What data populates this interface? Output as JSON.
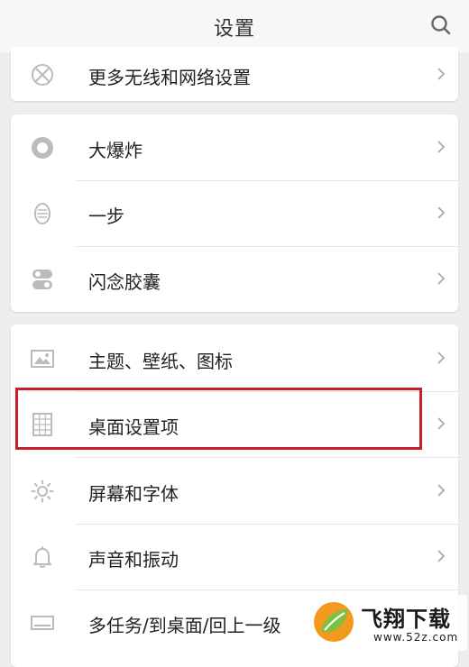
{
  "header": {
    "title": "设置",
    "search_icon": "search-icon"
  },
  "groups": [
    {
      "items": [
        {
          "label": "更多无线和网络设置",
          "icon": "network-globe-icon"
        }
      ]
    },
    {
      "items": [
        {
          "label": "大爆炸",
          "icon": "big-bang-icon"
        },
        {
          "label": "一步",
          "icon": "one-step-icon"
        },
        {
          "label": "闪念胶囊",
          "icon": "capsule-icon"
        }
      ]
    },
    {
      "items": [
        {
          "label": "主题、壁纸、图标",
          "icon": "image-icon"
        },
        {
          "label": "桌面设置项",
          "icon": "grid-icon",
          "highlighted": true
        },
        {
          "label": "屏幕和字体",
          "icon": "brightness-icon"
        },
        {
          "label": "声音和振动",
          "icon": "bell-icon"
        },
        {
          "label": "多任务/到桌面/回上一级",
          "icon": "keyboard-icon"
        }
      ]
    }
  ],
  "colors": {
    "highlight": "#c8202a",
    "background": "#eeeeee",
    "card": "#ffffff",
    "text": "#222222",
    "icon": "#bbbbbb"
  },
  "watermark": {
    "title": "飞翔下载",
    "url": "www.52z.com"
  }
}
